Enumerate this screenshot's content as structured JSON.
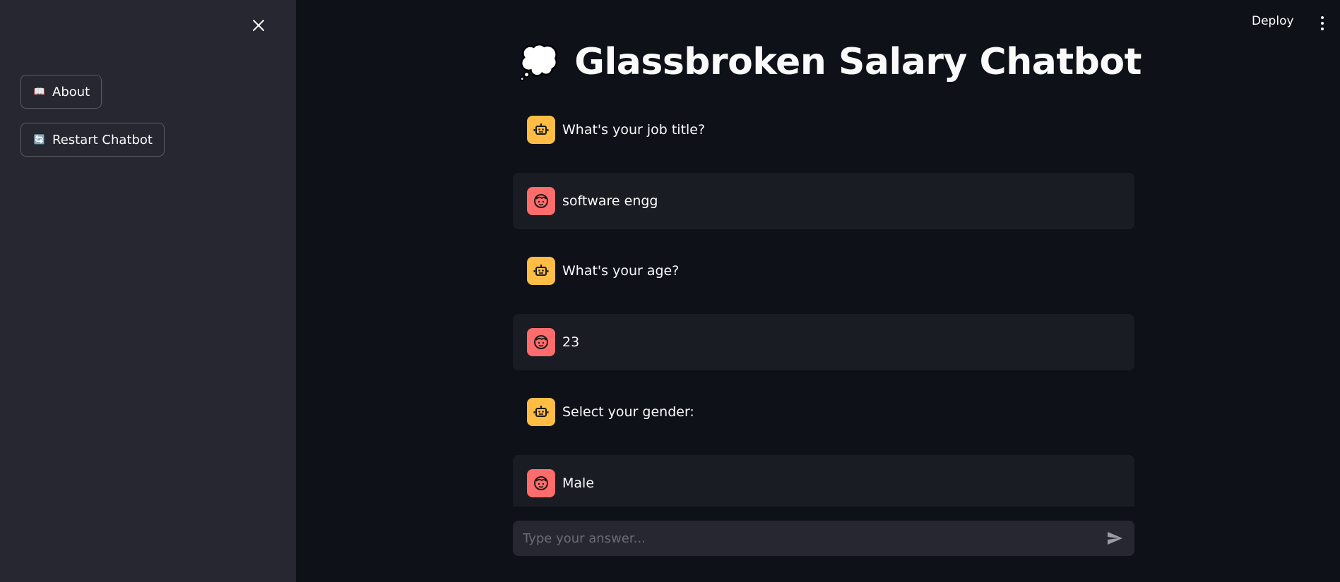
{
  "sidebar": {
    "buttons": [
      {
        "icon": "book-icon",
        "emoji": "📖",
        "label": "About"
      },
      {
        "icon": "refresh-icon",
        "emoji": "🔄",
        "label": "Restart Chatbot"
      }
    ]
  },
  "header": {
    "deploy_label": "Deploy"
  },
  "main": {
    "title_emoji": "💭",
    "title": "Glassbroken Salary Chatbot"
  },
  "messages": [
    {
      "role": "assistant",
      "text": "What's your job title?"
    },
    {
      "role": "user",
      "text": "software engg"
    },
    {
      "role": "assistant",
      "text": "What's your age?"
    },
    {
      "role": "user",
      "text": "23"
    },
    {
      "role": "assistant",
      "text": "Select your gender:"
    },
    {
      "role": "user",
      "text": "Male"
    }
  ],
  "input": {
    "placeholder": "Type your answer...",
    "value": ""
  },
  "colors": {
    "background": "#0e1117",
    "sidebar": "#262730",
    "bot_avatar": "#ffbd45",
    "user_avatar": "#ff6c6c",
    "user_message_bg": "#1a1c24"
  }
}
